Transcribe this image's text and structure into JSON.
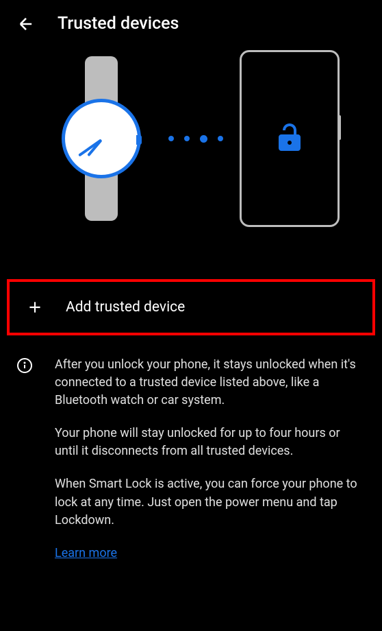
{
  "header": {
    "title": "Trusted devices"
  },
  "add_row": {
    "label": "Add trusted device"
  },
  "info": {
    "paragraph1": "After you unlock your phone, it stays unlocked when it's connected to a trusted device listed above, like a Bluetooth watch or car system.",
    "paragraph2": "Your phone will stay unlocked for up to four hours or until it disconnects from all trusted devices.",
    "paragraph3": "When Smart Lock is active, you can force your phone to lock at any time. Just open the power menu and tap Lockdown.",
    "learn_more": "Learn more"
  }
}
